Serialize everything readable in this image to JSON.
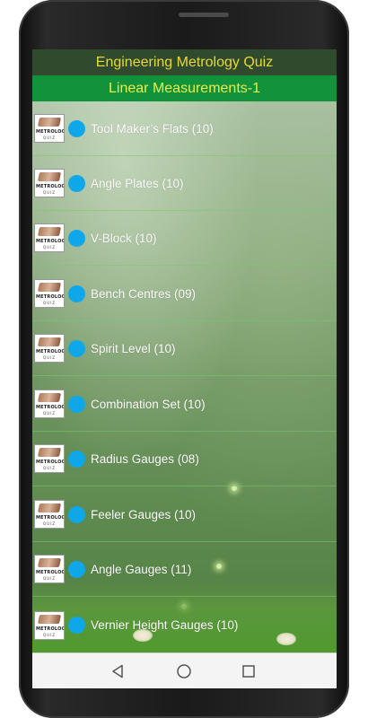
{
  "header": {
    "app_title": "Engineering Metrology Quiz",
    "section_title": "Linear Measurements-1"
  },
  "thumbnail": {
    "line1": "METROLOGY",
    "line2": "QUIZ"
  },
  "topics": [
    {
      "label": "Tool Maker’s Flats (10)"
    },
    {
      "label": "Angle Plates (10)"
    },
    {
      "label": "V-Block (10)"
    },
    {
      "label": "Bench Centres (09)"
    },
    {
      "label": "Spirit Level (10)"
    },
    {
      "label": "Combination Set (10)"
    },
    {
      "label": "Radius Gauges (08)"
    },
    {
      "label": "Feeler Gauges (10)"
    },
    {
      "label": "Angle Gauges (11)"
    },
    {
      "label": "Vernier Height Gauges (10)"
    }
  ],
  "navigation": {
    "back_icon": "back-triangle-icon",
    "home_icon": "home-circle-icon",
    "recents_icon": "recents-square-icon"
  },
  "colors": {
    "title_bar_bg": "#2f4a2c",
    "title_text": "#e8d83a",
    "section_bar_bg": "#12923a",
    "section_text": "#ecec4a",
    "dot_color": "#0ea8ea"
  }
}
